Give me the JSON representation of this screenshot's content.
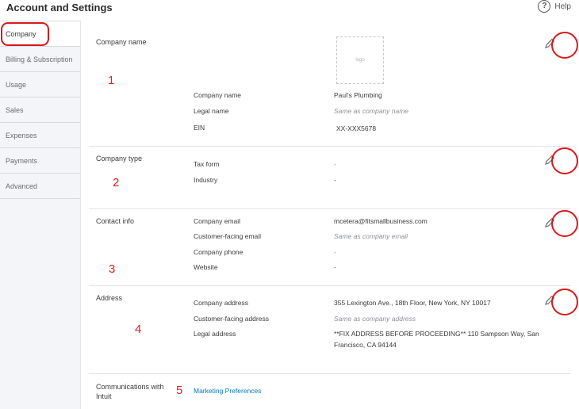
{
  "header": {
    "title": "Account and Settings",
    "help_label": "Help",
    "help_icon_glyph": "?"
  },
  "sidebar": {
    "items": [
      {
        "label": "Company",
        "active": true
      },
      {
        "label": "Billing & Subscription"
      },
      {
        "label": "Usage"
      },
      {
        "label": "Sales"
      },
      {
        "label": "Expenses"
      },
      {
        "label": "Payments"
      },
      {
        "label": "Advanced"
      }
    ]
  },
  "sections": {
    "company_name": {
      "title": "Company name",
      "logo_placeholder": "logo",
      "rows": [
        {
          "label": "Company name",
          "value": "Paul's Plumbing"
        },
        {
          "label": "Legal name",
          "value": "Same as company name"
        },
        {
          "label": "EIN",
          "value": "XX-XXX5678"
        }
      ]
    },
    "company_type": {
      "title": "Company type",
      "rows": [
        {
          "label": "Tax form",
          "value": "-"
        },
        {
          "label": "Industry",
          "value": "-"
        }
      ]
    },
    "contact_info": {
      "title": "Contact info",
      "rows": [
        {
          "label": "Company email",
          "value": "mcetera@fitsmallbusiness.com"
        },
        {
          "label": "Customer-facing email",
          "value": "Same as company email"
        },
        {
          "label": "Company phone",
          "value": "-"
        },
        {
          "label": "Website",
          "value": "-"
        }
      ]
    },
    "address": {
      "title": "Address",
      "rows": [
        {
          "label": "Company address",
          "value": "355 Lexington Ave., 18th Floor, New York, NY 10017"
        },
        {
          "label": "Customer-facing address",
          "value": "Same as company address"
        },
        {
          "label": "Legal address",
          "value": "**FIX ADDRESS BEFORE PROCEEDING** 110 Sampson Way, San Francisco, CA 94144"
        }
      ]
    },
    "communications": {
      "title": "Communications with Intuit",
      "link": "Marketing Preferences"
    }
  },
  "annotations": [
    "1",
    "2",
    "3",
    "4",
    "5"
  ],
  "colors": {
    "annotation_red": "#d81818",
    "link_blue": "#0077c5",
    "sidebar_bg": "#f4f5f8"
  }
}
